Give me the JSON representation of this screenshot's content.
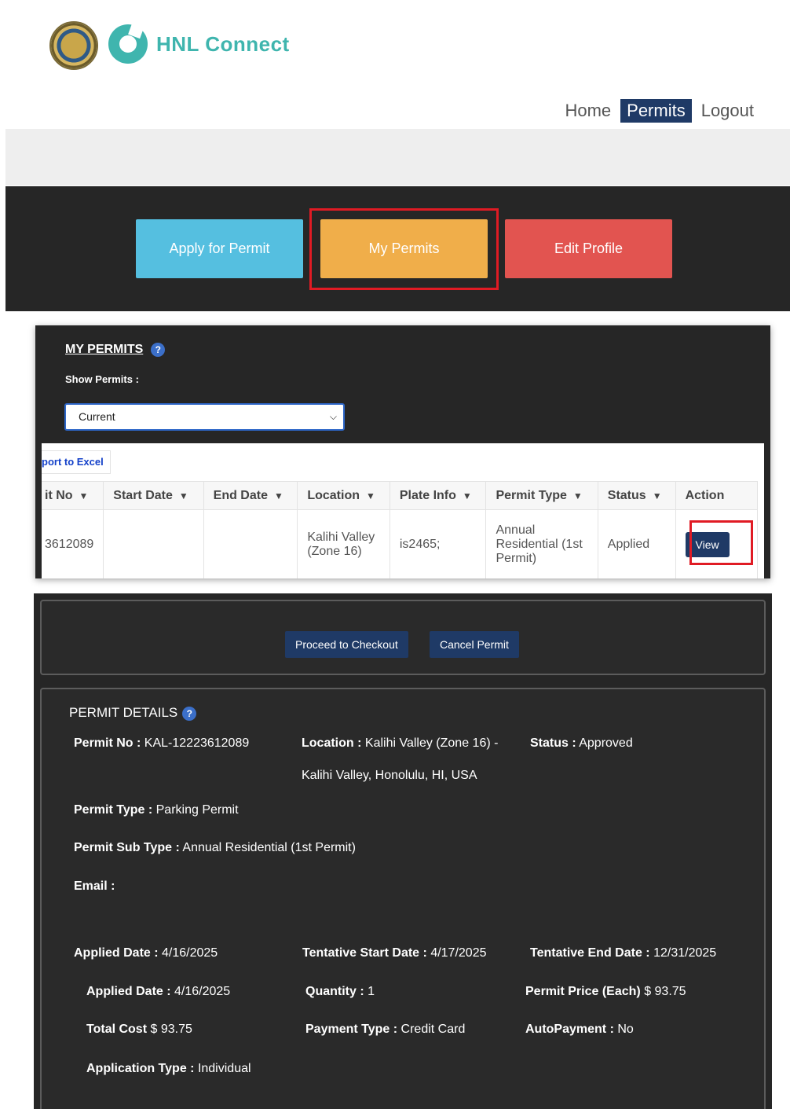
{
  "brand": {
    "name": "HNL Connect"
  },
  "nav": {
    "home": "Home",
    "permits": "Permits",
    "logout": "Logout"
  },
  "actions": {
    "apply": "Apply for Permit",
    "mine": "My Permits",
    "edit": "Edit Profile"
  },
  "my_permits": {
    "title": "MY PERMITS",
    "help": "?",
    "show_label": "Show Permits :",
    "select_value": "Current",
    "export": "port to Excel",
    "columns": [
      "it No",
      "Start Date",
      "End Date",
      "Location",
      "Plate Info",
      "Permit Type",
      "Status",
      "Action"
    ],
    "row": {
      "permit_no": "3612089",
      "start_date": "",
      "end_date": "",
      "location": "Kalihi Valley (Zone 16)",
      "plate": "is2465;",
      "permit_type": "Annual Residential (1st Permit)",
      "status": "Applied",
      "action": "View"
    }
  },
  "checkout": {
    "proceed": "Proceed to Checkout",
    "cancel": "Cancel Permit"
  },
  "details": {
    "title": "PERMIT DETAILS",
    "permit_no_label": "Permit No :",
    "permit_no": "KAL-12223612089",
    "location_label": "Location :",
    "location": "Kalihi Valley (Zone 16) -",
    "location_line2": "Kalihi Valley, Honolulu, HI, USA",
    "status_label": "Status :",
    "status": "Approved",
    "permit_type_label": "Permit Type :",
    "permit_type": "Parking Permit",
    "sub_type_label": "Permit Sub Type :",
    "sub_type": "Annual Residential (1st Permit)",
    "email_label": "Email :",
    "email": "",
    "applied_date_label": "Applied Date :",
    "applied_date": "4/16/2025",
    "start_label": "Tentative Start Date :",
    "start": "4/17/2025",
    "end_label": "Tentative End Date :",
    "end": "12/31/2025",
    "applied_date2_label": "Applied Date :",
    "applied_date2": "4/16/2025",
    "quantity_label": "Quantity :",
    "quantity": "1",
    "price_label": "Permit Price (Each)",
    "price": "$ 93.75",
    "total_label": "Total Cost",
    "total": "$ 93.75",
    "payment_label": "Payment Type :",
    "payment": "Credit Card",
    "autopay_label": "AutoPayment :",
    "autopay": "No",
    "app_type_label": "Application Type :",
    "app_type": "Individual"
  }
}
